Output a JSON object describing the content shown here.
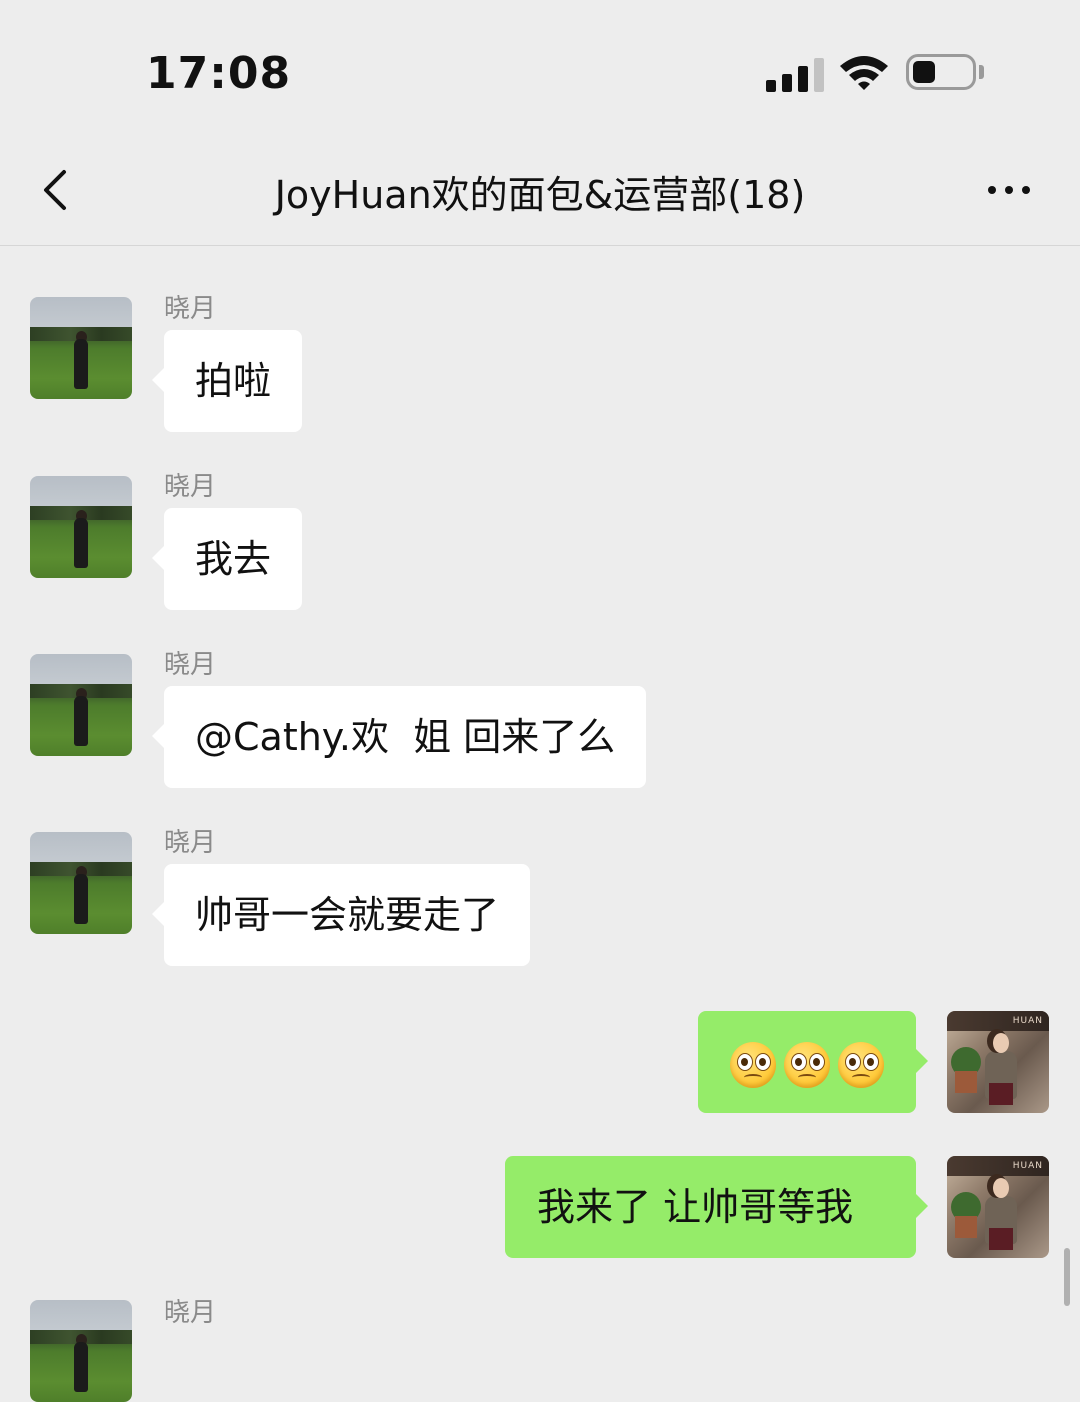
{
  "status_bar": {
    "time": "17:08"
  },
  "nav": {
    "title": "JoyHuan欢的面包&运营部(18)"
  },
  "messages": [
    {
      "sender": "晓月",
      "text": "拍啦",
      "side": "in"
    },
    {
      "sender": "晓月",
      "text": "我去",
      "side": "in"
    },
    {
      "sender": "晓月",
      "text": "@Cathy.欢  姐 回来了么",
      "side": "in"
    },
    {
      "sender": "晓月",
      "text": "帅哥一会就要走了",
      "side": "in"
    },
    {
      "sender": "",
      "emoji": [
        "pleading-face",
        "pleading-face",
        "pleading-face"
      ],
      "side": "out"
    },
    {
      "sender": "",
      "text": "我来了 让帅哥等我",
      "side": "out"
    },
    {
      "sender": "晓月",
      "text": "",
      "side": "in"
    }
  ],
  "colors": {
    "background": "#ededed",
    "incoming_bubble": "#ffffff",
    "outgoing_bubble": "#95ec69",
    "sender_name": "#8a8a8a"
  }
}
